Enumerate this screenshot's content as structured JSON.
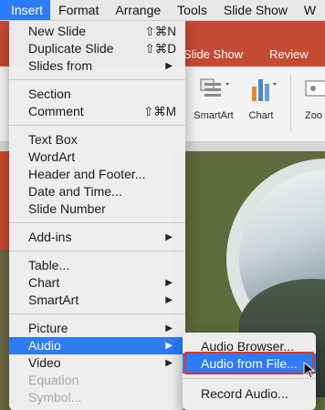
{
  "menubar": {
    "items": [
      "Insert",
      "Format",
      "Arrange",
      "Tools",
      "Slide Show",
      "W"
    ]
  },
  "ribbon": {
    "tabs": [
      "Slide Show",
      "Review"
    ],
    "buttons": [
      "SmartArt",
      "Chart",
      "Zoo"
    ],
    "accent_color": "#c64a33"
  },
  "insert_menu": {
    "new_slide": {
      "label": "New Slide",
      "shortcut": "⇧⌘N"
    },
    "duplicate_slide": {
      "label": "Duplicate Slide",
      "shortcut": "⇧⌘D"
    },
    "slides_from": {
      "label": "Slides from"
    },
    "section": {
      "label": "Section"
    },
    "comment": {
      "label": "Comment",
      "shortcut": "⇧⌘M"
    },
    "text_box": {
      "label": "Text Box"
    },
    "wordart": {
      "label": "WordArt"
    },
    "header_footer": {
      "label": "Header and Footer..."
    },
    "date_time": {
      "label": "Date and Time..."
    },
    "slide_number": {
      "label": "Slide Number"
    },
    "add_ins": {
      "label": "Add-ins"
    },
    "table": {
      "label": "Table..."
    },
    "chart": {
      "label": "Chart"
    },
    "smartart": {
      "label": "SmartArt"
    },
    "picture": {
      "label": "Picture"
    },
    "audio": {
      "label": "Audio"
    },
    "video": {
      "label": "Video"
    },
    "equation": {
      "label": "Equation"
    },
    "symbol": {
      "label": "Symbol..."
    }
  },
  "audio_submenu": {
    "audio_browser": "Audio Browser...",
    "audio_from_file": "Audio from File...",
    "record_audio": "Record Audio..."
  },
  "colors": {
    "highlight": "#2d7bf6",
    "callout_border": "#d9382b"
  }
}
